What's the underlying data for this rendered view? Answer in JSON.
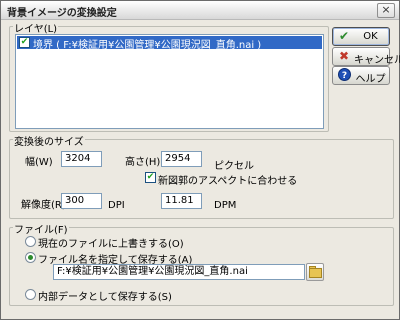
{
  "window": {
    "title": "背景イメージの変換設定",
    "close_glyph": "×"
  },
  "layers": {
    "group_label": "レイヤ(L)",
    "items": [
      {
        "checked": true,
        "label": "境界 ( F:¥検証用¥公園管理¥公園現況図_直角.nai )"
      }
    ]
  },
  "buttons": {
    "ok": {
      "label": "OK",
      "icon": "check-icon",
      "color": "#2e8b2e"
    },
    "cancel": {
      "label": "キャンセル",
      "icon": "x-icon",
      "color": "#c0392b"
    },
    "help": {
      "label": "ヘルプ",
      "icon": "help-icon",
      "color": "#1f4fb5"
    }
  },
  "size": {
    "group_label": "変換後のサイズ",
    "width_label": "幅(W)",
    "width_value": "3204",
    "height_label": "高さ(H)",
    "height_value": "2954",
    "unit_pixel": "ピクセル",
    "aspect_label": "新図郭のアスペクトに合わせる",
    "aspect_checked": true,
    "resolution_label": "解像度(R)",
    "dpi_value": "300",
    "dpi_unit": "DPI",
    "dpm_value": "11.81",
    "dpm_unit": "DPM"
  },
  "file": {
    "group_label": "ファイル(F)",
    "option_overwrite": "現在のファイルに上書きする(O)",
    "option_named": "ファイル名を指定して保存する(A)",
    "option_internal": "内部データとして保存する(S)",
    "selected": "named",
    "path_value": "F:¥検証用¥公園管理¥公園現況図_直角.nai"
  }
}
